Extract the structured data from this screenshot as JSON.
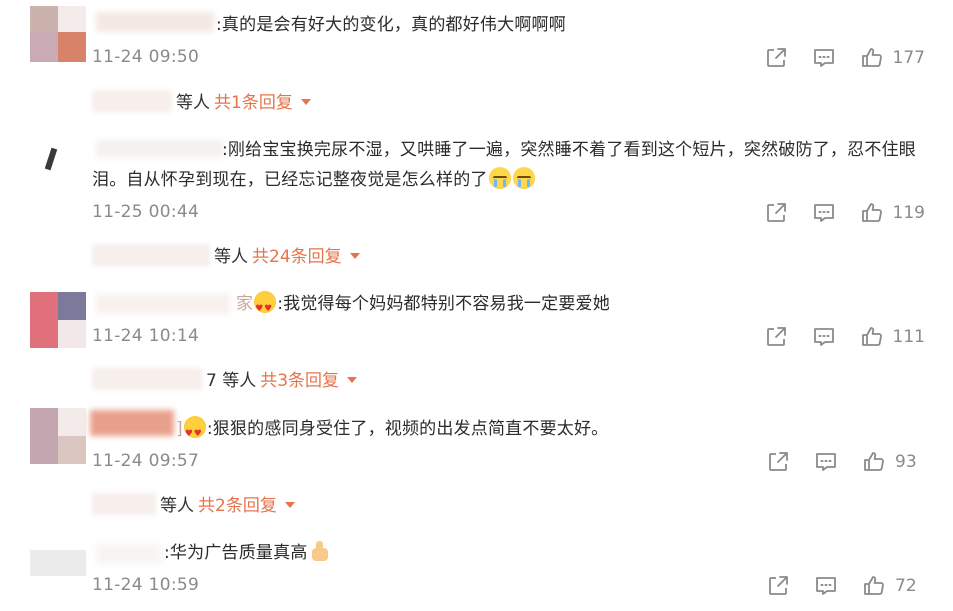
{
  "colors": {
    "accent": "#e5744b",
    "text": "#2b2b2b",
    "meta": "#8a8a8a",
    "icon": "#8a8a8a"
  },
  "action_icons": [
    "share-icon",
    "comment-icon",
    "like-icon"
  ],
  "comments": [
    {
      "text": ":真的是会有好大的变化，真的都好伟大啊啊啊",
      "time": "11-24 09:50",
      "likes": "177",
      "replies": {
        "who": "等人",
        "count_text": "共1条回复"
      }
    },
    {
      "text": ":刚给宝宝换完尿不湿，又哄睡了一遍，突然睡不着了看到这个短片，突然破防了，忍不住眼泪。自从怀孕到现在，已经忘记整夜觉是怎么样的了",
      "emojis": [
        "crying-emoji",
        "crying-emoji"
      ],
      "time": "11-25 00:44",
      "likes": "119",
      "replies": {
        "who": "等人",
        "count_text": "共24条回复"
      }
    },
    {
      "text": ":我觉得每个妈妈都特别不容易我一定要爱她",
      "name_tail": "家",
      "emojis": [
        "heart-eyes-emoji"
      ],
      "time": "11-24 10:14",
      "likes": "111",
      "replies": {
        "who": "7 等人",
        "count_text": "共3条回复"
      }
    },
    {
      "text": ":狠狠的感同身受住了，视频的出发点简直不要太好。",
      "name_tail": "]",
      "emojis": [
        "heart-eyes-emoji"
      ],
      "time": "11-24 09:57",
      "likes": "93",
      "replies": {
        "who": "等人",
        "count_text": "共2条回复"
      }
    },
    {
      "text": ":华为广告质量真高",
      "emojis": [
        "thumbs-up-emoji"
      ],
      "time": "11-24 10:59",
      "likes": "72"
    }
  ]
}
